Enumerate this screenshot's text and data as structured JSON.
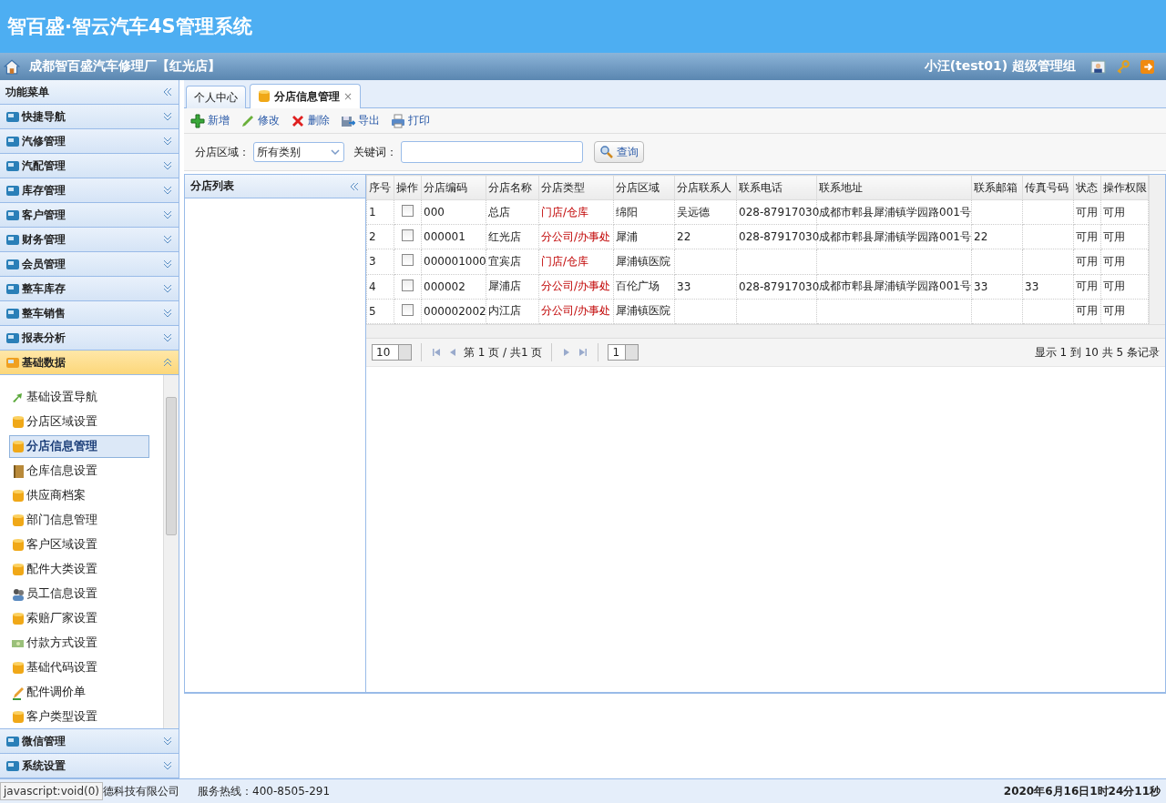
{
  "header": {
    "title": "智百盛·智云汽车4S管理系统"
  },
  "subheader": {
    "company": "成都智百盛汽车修理厂【红光店】",
    "user": "小汪(test01) 超级管理组"
  },
  "sidebar": {
    "title": "功能菜单",
    "items": [
      {
        "label": "快捷导航",
        "expanded": false
      },
      {
        "label": "汽修管理",
        "expanded": false
      },
      {
        "label": "汽配管理",
        "expanded": false
      },
      {
        "label": "库存管理",
        "expanded": false
      },
      {
        "label": "客户管理",
        "expanded": false
      },
      {
        "label": "财务管理",
        "expanded": false
      },
      {
        "label": "会员管理",
        "expanded": false
      },
      {
        "label": "整车库存",
        "expanded": false
      },
      {
        "label": "整车销售",
        "expanded": false
      },
      {
        "label": "报表分析",
        "expanded": false
      },
      {
        "label": "基础数据",
        "expanded": true,
        "children": [
          {
            "label": "基础设置导航",
            "kind": "arrows",
            "selected": false
          },
          {
            "label": "分店区域设置",
            "kind": "database",
            "selected": false
          },
          {
            "label": "分店信息管理",
            "kind": "database",
            "selected": true
          },
          {
            "label": "仓库信息设置",
            "kind": "book",
            "selected": false
          },
          {
            "label": "供应商档案",
            "kind": "database",
            "selected": false
          },
          {
            "label": "部门信息管理",
            "kind": "database",
            "selected": false
          },
          {
            "label": "客户区域设置",
            "kind": "database",
            "selected": false
          },
          {
            "label": "配件大类设置",
            "kind": "database",
            "selected": false
          },
          {
            "label": "员工信息设置",
            "kind": "people",
            "selected": false
          },
          {
            "label": "索赔厂家设置",
            "kind": "database",
            "selected": false
          },
          {
            "label": "付款方式设置",
            "kind": "money",
            "selected": false
          },
          {
            "label": "基础代码设置",
            "kind": "database",
            "selected": false
          },
          {
            "label": "配件调价单",
            "kind": "pencil",
            "selected": false
          },
          {
            "label": "客户类型设置",
            "kind": "database",
            "selected": false
          }
        ]
      },
      {
        "label": "微信管理",
        "expanded": false
      },
      {
        "label": "系统设置",
        "expanded": false
      }
    ]
  },
  "tabs": [
    {
      "label": "个人中心",
      "selected": false
    },
    {
      "label": "分店信息管理",
      "selected": true,
      "close": "×"
    }
  ],
  "toolbar": [
    {
      "label": "新增",
      "kind": "add"
    },
    {
      "label": "修改",
      "kind": "edit"
    },
    {
      "label": "删除",
      "kind": "delete"
    },
    {
      "label": "导出",
      "kind": "export"
    },
    {
      "label": "打印",
      "kind": "print"
    }
  ],
  "search": {
    "area_label": "分店区域：",
    "area_value": "所有类别",
    "keyword_label": "关键词：",
    "button": "查询"
  },
  "tree": {
    "title": "分店列表"
  },
  "table": {
    "columns": [
      {
        "label": "序号",
        "kind": "text"
      },
      {
        "label": "操作",
        "kind": "check"
      },
      {
        "label": "分店编码",
        "kind": "text"
      },
      {
        "label": "分店名称",
        "kind": "text"
      },
      {
        "label": "分店类型",
        "kind": "type"
      },
      {
        "label": "分店区域",
        "kind": "text"
      },
      {
        "label": "分店联系人",
        "kind": "text"
      },
      {
        "label": "联系电话",
        "kind": "text"
      },
      {
        "label": "联系地址",
        "kind": "text"
      },
      {
        "label": "联系邮箱",
        "kind": "text"
      },
      {
        "label": "传真号码",
        "kind": "text"
      },
      {
        "label": "状态",
        "kind": "text"
      },
      {
        "label": "操作权限",
        "kind": "text"
      }
    ],
    "rows": [
      {
        "checked": false,
        "cells": [
          "1",
          "",
          "000",
          "总店",
          "门店/仓库",
          "绵阳",
          "吴远德",
          "028-87917030",
          "成都市郫县犀浦镇学园路001号",
          "",
          "",
          "可用",
          "可用"
        ]
      },
      {
        "checked": false,
        "cells": [
          "2",
          "",
          "000001",
          "红光店",
          "分公司/办事处",
          "犀浦",
          "22",
          "028-87917030",
          "成都市郫县犀浦镇学园路001号",
          "22",
          "",
          "可用",
          "可用"
        ]
      },
      {
        "checked": false,
        "cells": [
          "3",
          "",
          "000001000",
          "宜宾店",
          "门店/仓库",
          "犀浦镇医院",
          "",
          "",
          "",
          "",
          "",
          "可用",
          "可用"
        ]
      },
      {
        "checked": false,
        "cells": [
          "4",
          "",
          "000002",
          "犀浦店",
          "分公司/办事处",
          "百伦广场",
          "33",
          "028-87917030",
          "成都市郫县犀浦镇学园路001号",
          "33",
          "33",
          "可用",
          "可用"
        ]
      },
      {
        "checked": false,
        "cells": [
          "5",
          "",
          "000002002",
          "内江店",
          "分公司/办事处",
          "犀浦镇医院",
          "",
          "",
          "",
          "",
          "",
          "可用",
          "可用"
        ]
      }
    ]
  },
  "pager": {
    "page_size": "10",
    "page_text": "第 1 页 / 共1 页",
    "page": "1",
    "summary": "显示 1 到 10 共 5 条记录"
  },
  "status_bar": {
    "browser_status": "javascript:void(0)",
    "company": "德科技有限公司",
    "hotline": "服务热线：400-8505-291",
    "datetime": "2020年6月16日1时24分11秒"
  }
}
